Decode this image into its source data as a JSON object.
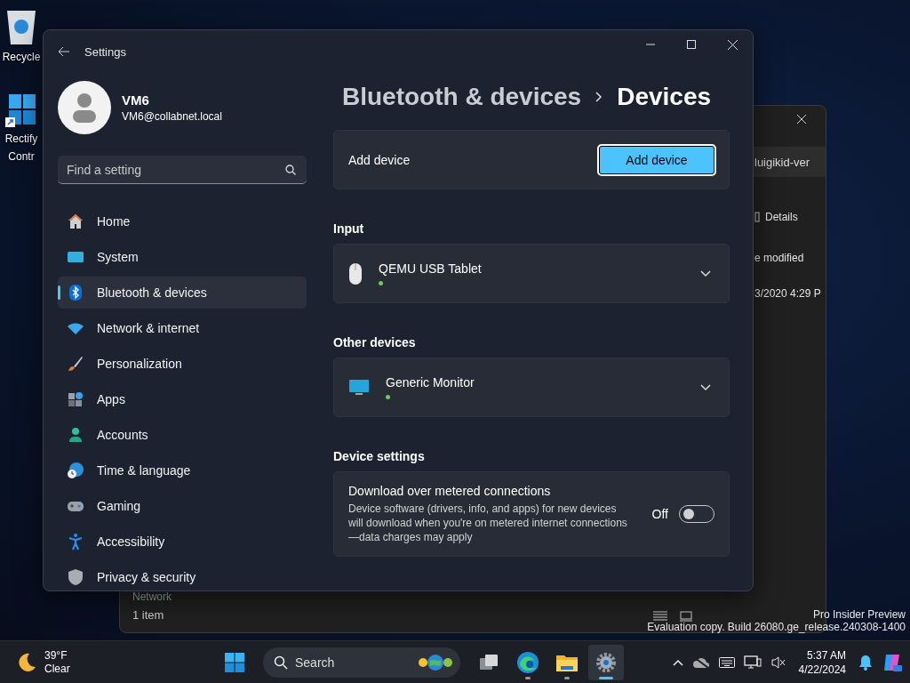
{
  "desktop_icons": [
    {
      "kind": "recycle-bin",
      "lines": [
        "Recycle"
      ]
    },
    {
      "kind": "shortcut",
      "lines": [
        "Rectify",
        "Contr"
      ]
    }
  ],
  "explorer_window": {
    "address": "luigikid-ver",
    "details_button": "Details",
    "column_heading": "e modified",
    "row_date": "3/2020 4:29 P",
    "nav_item": "Network",
    "status": "1 item"
  },
  "watermark": [
    "Pro Insider Preview",
    "Evaluation copy. Build 26080.ge_release.240308-1400"
  ],
  "settings_window": {
    "title": "Settings",
    "account": {
      "name": "VM6",
      "email": "VM6@collabnet.local"
    },
    "search": {
      "placeholder": "Find a setting"
    },
    "nav": [
      {
        "kind": "home",
        "label": "Home",
        "selected": false
      },
      {
        "kind": "system",
        "label": "System",
        "selected": false
      },
      {
        "kind": "bluetooth",
        "label": "Bluetooth & devices",
        "selected": true
      },
      {
        "kind": "network",
        "label": "Network & internet",
        "selected": false
      },
      {
        "kind": "personalization",
        "label": "Personalization",
        "selected": false
      },
      {
        "kind": "apps",
        "label": "Apps",
        "selected": false
      },
      {
        "kind": "accounts",
        "label": "Accounts",
        "selected": false
      },
      {
        "kind": "time",
        "label": "Time & language",
        "selected": false
      },
      {
        "kind": "gaming",
        "label": "Gaming",
        "selected": false
      },
      {
        "kind": "accessibility",
        "label": "Accessibility",
        "selected": false
      },
      {
        "kind": "privacy",
        "label": "Privacy & security",
        "selected": false
      }
    ],
    "breadcrumb": [
      "Bluetooth & devices",
      "Devices"
    ],
    "add_device": {
      "label": "Add device",
      "button": "Add device"
    },
    "sections": [
      {
        "heading": "Input",
        "devices": [
          {
            "kind": "mouse",
            "name": "QEMU USB Tablet",
            "connected": true
          }
        ]
      },
      {
        "heading": "Other devices",
        "devices": [
          {
            "kind": "monitor",
            "name": "Generic Monitor",
            "connected": true
          }
        ]
      }
    ],
    "device_settings": {
      "heading": "Device settings",
      "title": "Download over metered connections",
      "description": "Device software (drivers, info, and apps) for new devices will download when you're on metered internet connections—data charges may apply",
      "state_label": "Off",
      "on": false
    }
  },
  "taskbar": {
    "weather": {
      "temperature": "39°F",
      "condition": "Clear"
    },
    "search": "Search",
    "apps": [
      {
        "kind": "start",
        "running": false,
        "active": false
      },
      {
        "kind": "task-view",
        "running": false,
        "active": false
      },
      {
        "kind": "edge",
        "running": true,
        "active": false
      },
      {
        "kind": "explorer",
        "running": true,
        "active": false
      },
      {
        "kind": "settings",
        "running": true,
        "active": true
      }
    ],
    "time": "5:37 AM",
    "date": "4/22/2024"
  }
}
